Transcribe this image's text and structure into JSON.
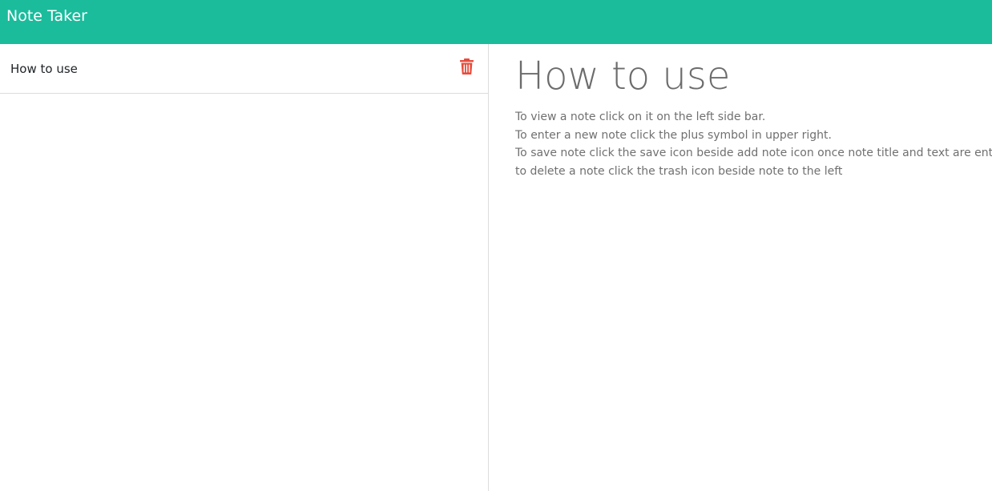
{
  "app": {
    "brand": "Note Taker",
    "accent_color": "#1abc9c"
  },
  "sidebar": {
    "notes": [
      {
        "title": "How to use",
        "delete_icon": "trash-icon",
        "delete_color": "#e74c3c"
      }
    ]
  },
  "main": {
    "title": "How to use",
    "lines": [
      "To view a note click on it on the left side bar.",
      "To enter a new note click the plus symbol in upper right.",
      "To save note click the save icon beside add note icon once note title and text are entered",
      "to delete a note click the trash icon beside note to the left"
    ]
  }
}
